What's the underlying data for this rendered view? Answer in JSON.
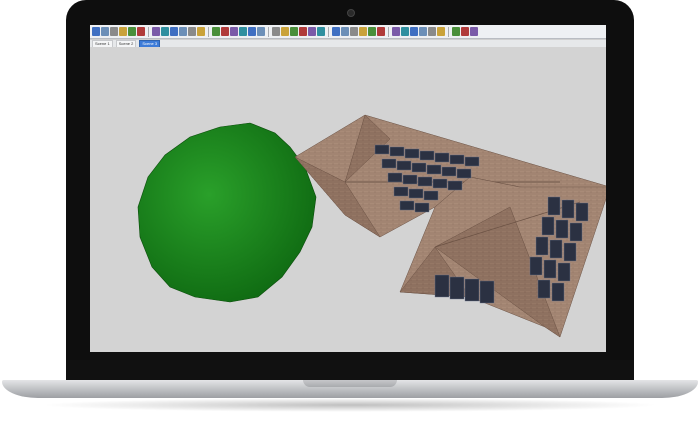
{
  "scene_tabs": [
    {
      "label": "Scene 1",
      "active": false
    },
    {
      "label": "Scene 2",
      "active": false
    },
    {
      "label": "Scene 3",
      "active": true
    }
  ],
  "toolbar_icons": [
    "select-icon",
    "pencil-icon",
    "eraser-icon",
    "paint-bucket-icon",
    "push-pull-icon",
    "orbit-icon",
    "pan-icon",
    "zoom-icon",
    "zoom-extents-icon",
    "component-icon",
    "group-icon",
    "camera-icon",
    "walk-icon",
    "look-around-icon",
    "section-plane-icon",
    "iso-view-icon",
    "top-view-icon",
    "front-view-icon",
    "right-view-icon",
    "back-view-icon",
    "left-view-icon",
    "xray-icon",
    "wireframe-icon",
    "hidden-line-icon",
    "shaded-icon",
    "textured-icon",
    "monochrome-icon",
    "shadows-icon",
    "fog-icon",
    "warehouse-icon",
    "extension-icon",
    "layers-icon",
    "outliner-icon",
    "materials-icon",
    "styles-icon",
    "solar-panel-icon",
    "sun-icon",
    "compass-icon",
    "settings-icon"
  ],
  "colors": {
    "viewport_bg": "#d3d3d3",
    "tree": "#1f8a1f",
    "roof": "#a98b78",
    "panel": "#2b3142"
  }
}
